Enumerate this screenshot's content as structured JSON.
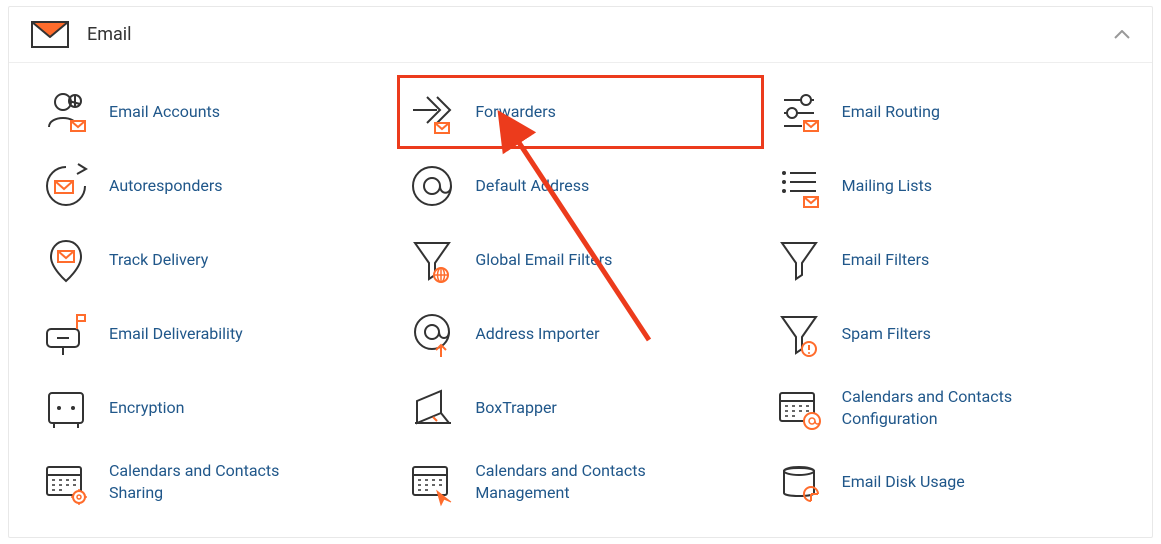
{
  "colors": {
    "link": "#20578a",
    "accent": "#ff6c2c",
    "outline": "#333333",
    "highlight": "#ec3b1c"
  },
  "panel": {
    "title": "Email"
  },
  "items": [
    {
      "label": "Email Accounts"
    },
    {
      "label": "Forwarders"
    },
    {
      "label": "Email Routing"
    },
    {
      "label": "Autoresponders"
    },
    {
      "label": "Default Address"
    },
    {
      "label": "Mailing Lists"
    },
    {
      "label": "Track Delivery"
    },
    {
      "label": "Global Email Filters"
    },
    {
      "label": "Email Filters"
    },
    {
      "label": "Email Deliverability"
    },
    {
      "label": "Address Importer"
    },
    {
      "label": "Spam Filters"
    },
    {
      "label": "Encryption"
    },
    {
      "label": "BoxTrapper"
    },
    {
      "label": "Calendars and Contacts Configuration"
    },
    {
      "label": "Calendars and Contacts Sharing"
    },
    {
      "label": "Calendars and Contacts Management"
    },
    {
      "label": "Email Disk Usage"
    }
  ]
}
